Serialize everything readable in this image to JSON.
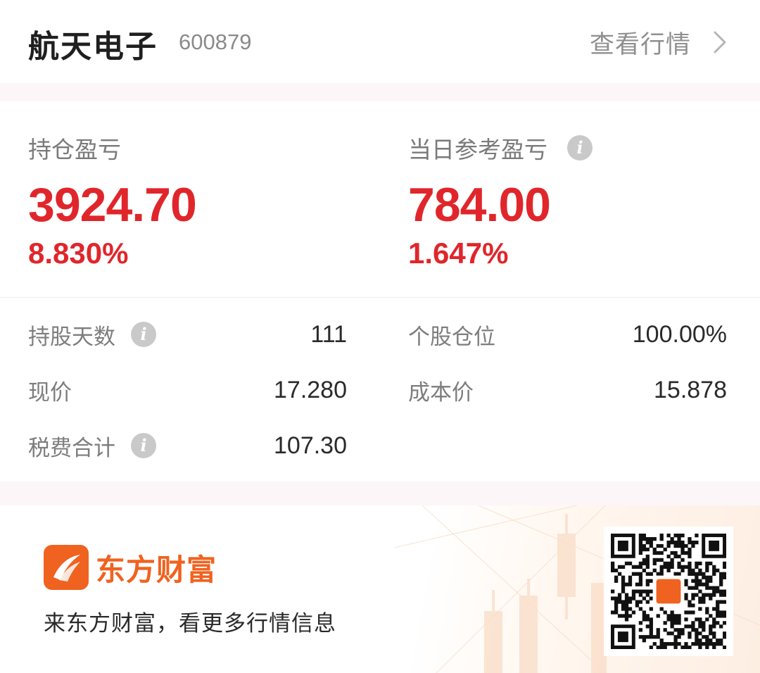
{
  "header": {
    "stock_name": "航天电子",
    "stock_code": "600879",
    "quote_link_label": "查看行情"
  },
  "pnl": {
    "position": {
      "label": "持仓盈亏",
      "value": "3924.70",
      "percent": "8.830%"
    },
    "daily": {
      "label": "当日参考盈亏",
      "value": "784.00",
      "percent": "1.647%"
    }
  },
  "details": {
    "holding_days": {
      "label": "持股天数",
      "value": "111"
    },
    "position_ratio": {
      "label": "个股仓位",
      "value": "100.00%"
    },
    "current_price": {
      "label": "现价",
      "value": "17.280"
    },
    "cost_price": {
      "label": "成本价",
      "value": "15.878"
    },
    "total_fees": {
      "label": "税费合计",
      "value": "107.30"
    }
  },
  "promo": {
    "brand_name": "东方财富",
    "tagline": "来东方财富，看更多行情信息"
  },
  "icons": {
    "info": "i",
    "chevron": "chevron-right-icon",
    "logo": "eastmoney-logo-icon",
    "qr": "qr-code"
  },
  "colors": {
    "gain": "#e0262b",
    "brand": "#f0621f",
    "muted_text": "#7d7d7d"
  }
}
